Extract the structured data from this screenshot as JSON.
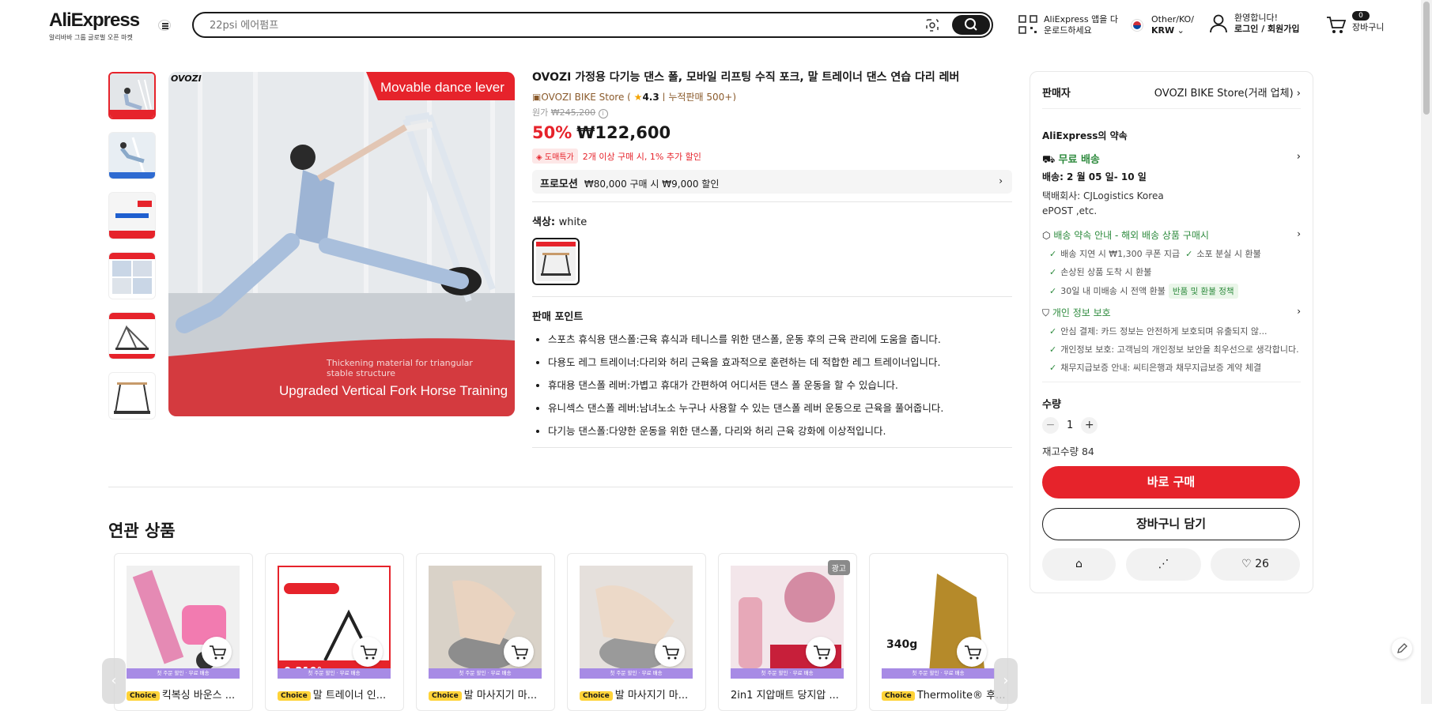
{
  "header": {
    "logo_text": "AliExpress",
    "logo_tagline": "알리바바 그룹 글로벌 오픈 마켓",
    "search_placeholder": "22psi 에어펌프",
    "app_line1": "AliExpress 앱을 다",
    "app_line2": "운로드하세요",
    "locale_line1": "Other/KO/",
    "locale_line2": "KRW",
    "account_line1": "환영합니다!",
    "account_line2": "로그인 / 회원가입",
    "cart_count": "0",
    "cart_label": "장바구니"
  },
  "product": {
    "title": "OVOZI 가정용 다기능 댄스 폴, 모바일 리프팅 수직 포크, 말 트레이너 댄스 연습 다리 레버",
    "store_name": "OVOZI BIKE Store",
    "rating": "4.3",
    "sold": "누적판매 500+",
    "original_label": "원가",
    "original_price": "₩245,200",
    "discount": "50%",
    "price": "₩122,600",
    "deal_badge": "도매특가",
    "deal_text": "2개 이상 구매 시, 1% 추가 할인",
    "promo_label": "프로모션",
    "promo_text": "₩80,000 구매 시 ₩9,000 할인",
    "color_label": "색상:",
    "color_value": "white",
    "image_brand": "OVOZI",
    "image_banner_top": "Movable dance lever",
    "image_caption_small": "Thickening material for triangular stable structure",
    "image_banner_bottom": "Upgraded Vertical Fork Horse Training",
    "selling_points_title": "판매 포인트",
    "selling_points": [
      "스포츠 휴식용 댄스폴:근육 휴식과 테니스를 위한 댄스폴, 운동 후의 근육 관리에 도움을 줍니다.",
      "다용도 레그 트레이너:다리와 허리 근육을 효과적으로 훈련하는 데 적합한 레그 트레이너입니다.",
      "휴대용 댄스폴 레버:가볍고 휴대가 간편하여 어디서든 댄스 폴 운동을 할 수 있습니다.",
      "유니섹스 댄스폴 레버:남녀노소 누구나 사용할 수 있는 댄스폴 레버 운동으로 근육을 풀어줍니다.",
      "다기능 댄스폴:다양한 운동을 위한 댄스폴, 다리와 허리 근육 강화에 이상적입니다."
    ]
  },
  "panel": {
    "seller_label": "판매자",
    "seller_name": "OVOZI BIKE Store(거래 업체)",
    "promise_title": "AliExpress의 약속",
    "free_shipping": "무료 배송",
    "delivery": "배송: 2 월 05 일- 10 일",
    "carrier_line1": "택배회사: CJLogistics  Korea",
    "carrier_line2": "ePOST ,etc.",
    "guarantee_title": "배송 약속 안내 - 해외 배송 상품 구매시",
    "guarantee_items": [
      "배송 지연 시 ₩1,300 쿠폰 지급",
      "소포 분실 시 환불",
      "손상된 상품 도착 시 환불",
      "30일 내 미배송 시 전액 환불"
    ],
    "refund_pill": "반품 및 환불 정책",
    "privacy_title": "개인 정보 보호",
    "privacy_items": [
      "안심 결제: 카드 정보는 안전하게 보호되며 유출되지 않...",
      "개인정보 보호: 고객님의 개인정보 보안을 최우선으로 생각합니다.",
      "채무지급보증 안내: 씨티은행과 채무지급보증 계약 체결"
    ],
    "qty_label": "수량",
    "qty_value": "1",
    "stock": "재고수량 84",
    "buy_now": "바로 구매",
    "add_cart": "장바구니 담기",
    "wishlist_count": "26"
  },
  "related": {
    "title": "연관 상품",
    "strip_text": "첫 주문 할인 · 무료 배송",
    "ad_tag": "광고",
    "choice_label": "Choice",
    "items": [
      {
        "title": "킥복싱 바운스 ..."
      },
      {
        "title": "말 트레이너 인..."
      },
      {
        "title": "발 마사지기 마..."
      },
      {
        "title": "발 마사지기 마..."
      },
      {
        "title": "2in1 지압매트 당지압 ..."
      },
      {
        "title": "Thermolite® 후..."
      }
    ]
  },
  "colors": {
    "accent": "#e6232b",
    "green": "#2e8b3e",
    "choice": "#ffd338",
    "strip": "#a78be5"
  }
}
